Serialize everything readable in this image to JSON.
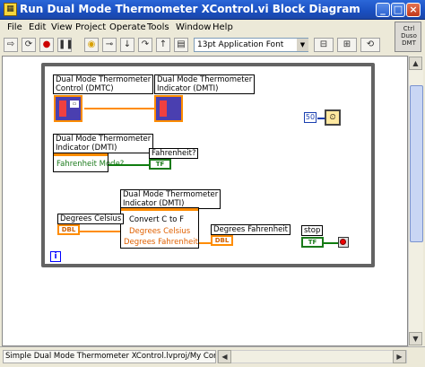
{
  "window": {
    "title": "Run Dual Mode Thermometer XControl.vi Block Diagram",
    "minimize": "_",
    "maximize": "□",
    "close": "×"
  },
  "menu": [
    "File",
    "Edit",
    "View",
    "Project",
    "Operate",
    "Tools",
    "Window",
    "Help"
  ],
  "toolbar": {
    "font_select": "13pt Application Font"
  },
  "context_help_box": "Ctrl Duso DMT",
  "diagram": {
    "xcontrol_top_label": "Dual Mode Thermometer\nControl (DMTC)",
    "xcontrol_indicator_label": "Dual Mode Thermometer\nIndicator (DMTI)",
    "prop_node1_header": "Dual Mode Thermometer\nIndicator (DMTI)",
    "prop_node1_row": "Fahrenheit Mode?",
    "fahrenheit_label": "Fahrenheit?",
    "fahrenheit_term": "TF",
    "prop_node2_header": "Dual Mode Thermometer\nIndicator (DMTI)",
    "prop_node2_rows": [
      "Convert C to F",
      "Degrees Celsius",
      "Degrees Fahrenheit"
    ],
    "celsius_label": "Degrees Celsius",
    "celsius_term": "DBL",
    "fahrenheit_out_label": "Degrees Fahrenheit",
    "fahrenheit_out_term": "DBL",
    "stop_label": "stop",
    "stop_term": "TF",
    "wait_const": "50",
    "loop_info": "i"
  },
  "status": {
    "path": "Simple Dual Mode Thermometer XControl.lvproj/My Computer"
  },
  "colors": {
    "title_blue": "#1a4fc0",
    "wire_orange": "#ff8c00",
    "wire_green": "#0f7d0f",
    "loop_border": "#636363"
  }
}
